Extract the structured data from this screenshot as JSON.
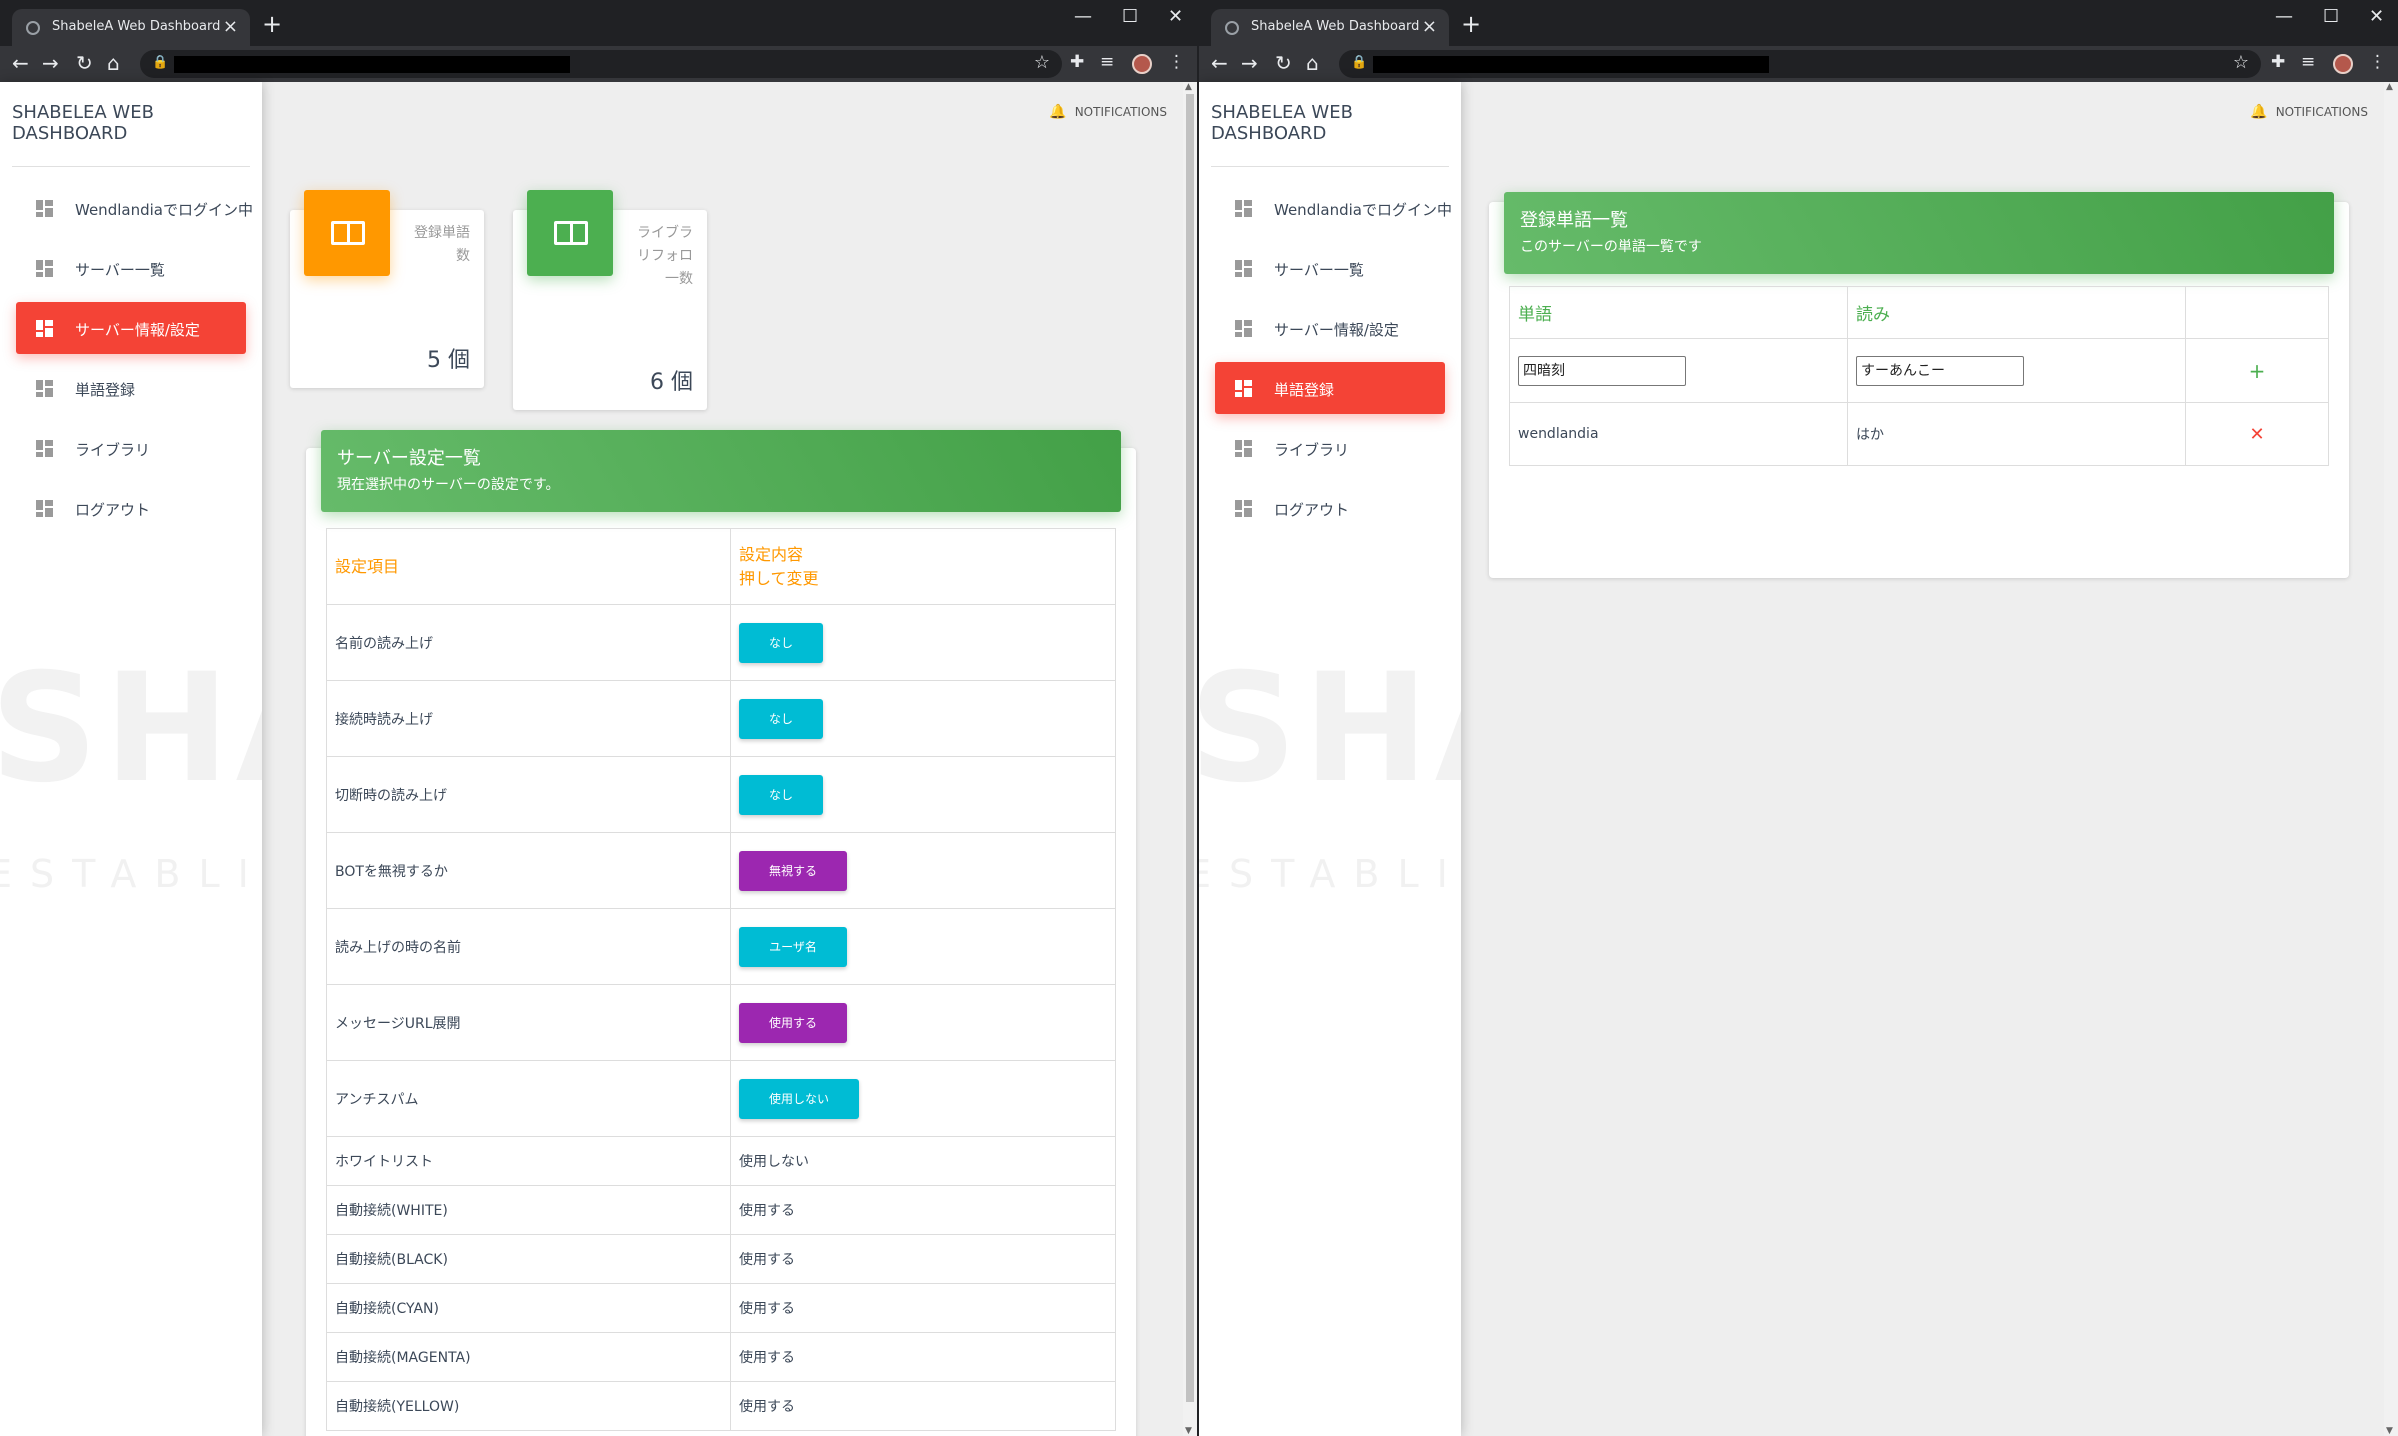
{
  "left": {
    "tab_title": "ShabeleA Web Dashboard",
    "sidebar_title": "SHABELEA WEB DASHBOARD",
    "nav": [
      {
        "label": "Wendlandiaでログイン中"
      },
      {
        "label": "サーバー一覧"
      },
      {
        "label": "サーバー情報/設定",
        "active": true
      },
      {
        "label": "単語登録"
      },
      {
        "label": "ライブラリ"
      },
      {
        "label": "ログアウト"
      }
    ],
    "notifications": "NOTIFICATIONS",
    "stats": [
      {
        "label1": "登録単語",
        "label2": "数",
        "value": "5 個",
        "color": "#ff9800"
      },
      {
        "label1": "ライブラ",
        "label2": "リフォロ",
        "label3": "一数",
        "value": "6 個",
        "color": "#4caf50"
      }
    ],
    "card": {
      "title": "サーバー設定一覧",
      "subtitle": "現在選択中のサーバーの設定です。",
      "col1": "設定項目",
      "col2a": "設定内容",
      "col2b": "押して変更",
      "rows": [
        {
          "label": "名前の読み上げ",
          "value": "なし",
          "kind": "btn",
          "color": "cyan"
        },
        {
          "label": "接続時読み上げ",
          "value": "なし",
          "kind": "btn",
          "color": "cyan"
        },
        {
          "label": "切断時の読み上げ",
          "value": "なし",
          "kind": "btn",
          "color": "cyan"
        },
        {
          "label": "BOTを無視するか",
          "value": "無視する",
          "kind": "btn",
          "color": "purple"
        },
        {
          "label": "読み上げの時の名前",
          "value": "ユーザ名",
          "kind": "btn",
          "color": "cyan"
        },
        {
          "label": "メッセージURL展開",
          "value": "使用する",
          "kind": "btn",
          "color": "purple"
        },
        {
          "label": "アンチスパム",
          "value": "使用しない",
          "kind": "btn",
          "color": "cyan"
        },
        {
          "label": "ホワイトリスト",
          "value": "使用しない",
          "kind": "text"
        },
        {
          "label": "自動接続(WHITE)",
          "value": "使用する",
          "kind": "text"
        },
        {
          "label": "自動接続(BLACK)",
          "value": "使用する",
          "kind": "text"
        },
        {
          "label": "自動接続(CYAN)",
          "value": "使用する",
          "kind": "text"
        },
        {
          "label": "自動接続(MAGENTA)",
          "value": "使用する",
          "kind": "text"
        },
        {
          "label": "自動接続(YELLOW)",
          "value": "使用する",
          "kind": "text"
        }
      ]
    }
  },
  "right": {
    "tab_title": "ShabeleA Web Dashboard",
    "sidebar_title": "SHABELEA WEB DASHBOARD",
    "nav": [
      {
        "label": "Wendlandiaでログイン中"
      },
      {
        "label": "サーバー一覧"
      },
      {
        "label": "サーバー情報/設定"
      },
      {
        "label": "単語登録",
        "active": true
      },
      {
        "label": "ライブラリ"
      },
      {
        "label": "ログアウト"
      }
    ],
    "notifications": "NOTIFICATIONS",
    "card": {
      "title": "登録単語一覧",
      "subtitle": "このサーバーの単語一覧です",
      "col_word": "単語",
      "col_reading": "読み",
      "input_word": "四暗刻",
      "input_reading": "すーあんこー",
      "add_symbol": "+",
      "entries": [
        {
          "word": "wendlandia",
          "reading": "はか",
          "delete_symbol": "✕"
        }
      ]
    }
  },
  "sidebar_watermark": "SHABEL",
  "sidebar_watermark2": "ESTABLISHED",
  "colors": {
    "active": "#f44336",
    "green": "#4caf50",
    "orange": "#ff9800",
    "cyan": "#00bcd4",
    "purple": "#9c27b0"
  }
}
